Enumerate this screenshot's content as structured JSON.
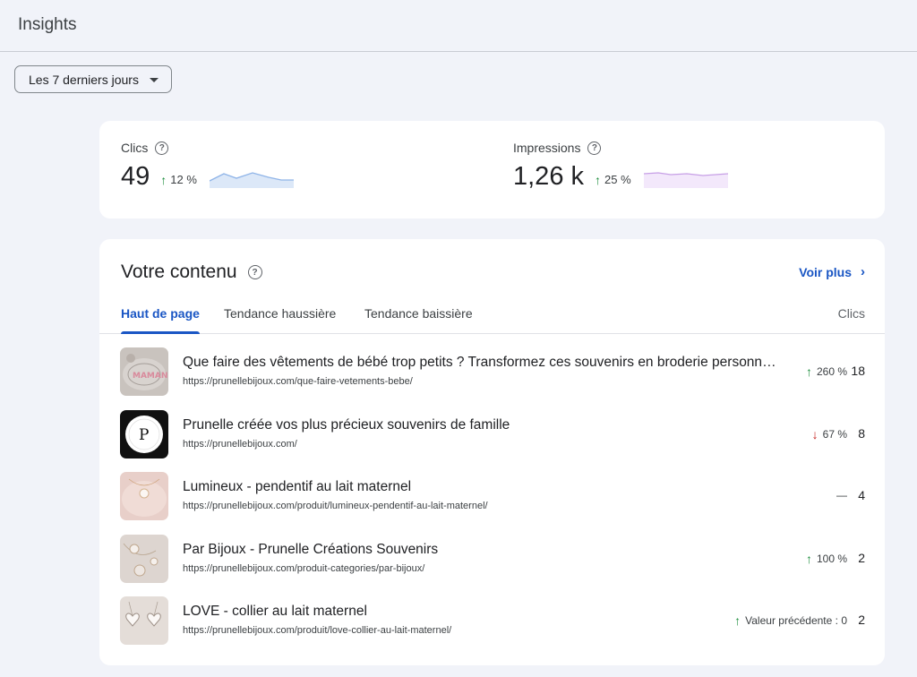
{
  "header": {
    "title": "Insights"
  },
  "date_range": {
    "label": "Les 7 derniers jours"
  },
  "metrics": [
    {
      "label": "Clics",
      "value": "49",
      "change": "12 %",
      "direction": "up",
      "color": "#8fb4e8",
      "fill": "#dce8f8"
    },
    {
      "label": "Impressions",
      "value": "1,26 k",
      "change": "25 %",
      "direction": "up",
      "color": "#c7a0e6",
      "fill": "#f3e8fb"
    }
  ],
  "content": {
    "title": "Votre contenu",
    "see_more": "Voir plus",
    "tabs": [
      {
        "label": "Haut de page",
        "active": true
      },
      {
        "label": "Tendance haussière",
        "active": false
      },
      {
        "label": "Tendance baissière",
        "active": false
      }
    ],
    "column_header": "Clics",
    "rows": [
      {
        "title": "Que faire des vêtements de bébé trop petits ? Transformez ces souvenirs en broderie personnalisée",
        "url": "https://prunellebijoux.com/que-faire-vetements-bebe/",
        "change": "260 %",
        "direction": "up",
        "clicks": "18",
        "thumb": "embroidery"
      },
      {
        "title": "Prunelle créée vos plus précieux souvenirs de famille",
        "url": "https://prunellebijoux.com/",
        "change": "67 %",
        "direction": "down",
        "clicks": "8",
        "thumb": "logo"
      },
      {
        "title": "Lumineux - pendentif au lait maternel",
        "url": "https://prunellebijoux.com/produit/lumineux-pendentif-au-lait-maternel/",
        "change": "—",
        "direction": "flat",
        "clicks": "4",
        "thumb": "pendant"
      },
      {
        "title": "Par Bijoux - Prunelle Créations Souvenirs",
        "url": "https://prunellebijoux.com/produit-categories/par-bijoux/",
        "change": "100 %",
        "direction": "up",
        "clicks": "2",
        "thumb": "jewels"
      },
      {
        "title": "LOVE - collier au lait maternel",
        "url": "https://prunellebijoux.com/produit/love-collier-au-lait-maternel/",
        "change": "Valeur précédente : 0",
        "direction": "up",
        "clicks": "2",
        "thumb": "hearts"
      }
    ]
  }
}
